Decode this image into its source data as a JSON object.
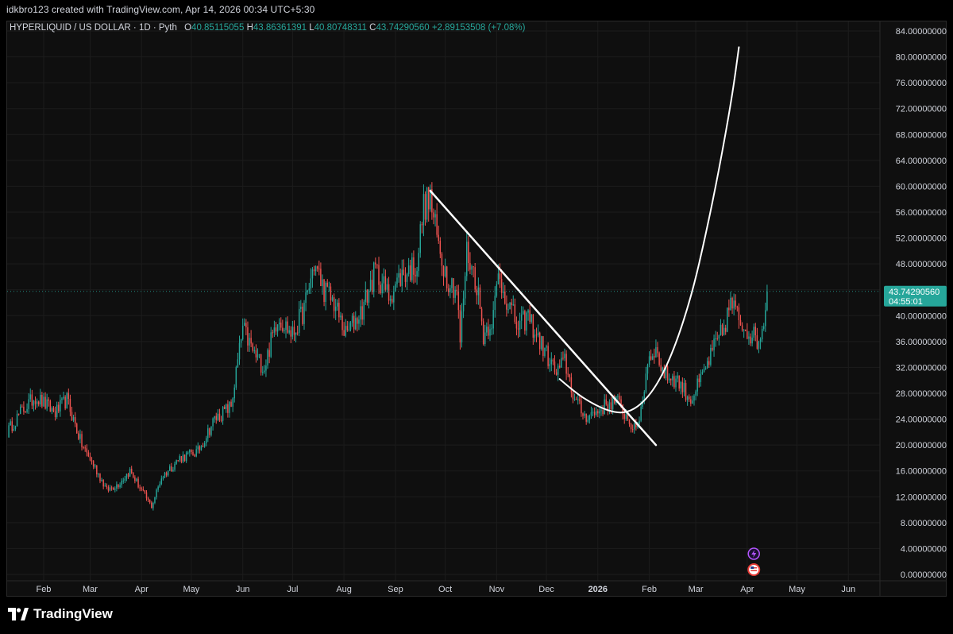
{
  "header": {
    "credit": "idkbro123 created with TradingView.com, Apr 14, 2026 00:34 UTC+5:30"
  },
  "legend": {
    "symbol": "HYPERLIQUID / US DOLLAR · 1D · Pyth",
    "open_label": "O",
    "open": "40.85115055",
    "high_label": "H",
    "high": "43.86361391",
    "low_label": "L",
    "low": "40.80748311",
    "close_label": "C",
    "close": "43.74290560",
    "change": "+2.89153508 (+7.08%)"
  },
  "price_label": {
    "value": "43.74290560",
    "countdown": "04:55:01",
    "price": 43.7429056
  },
  "brand": {
    "name": "TradingView"
  },
  "colors": {
    "up": "#26a69a",
    "down": "#ef5350",
    "background": "#0f0f0f",
    "axis_text": "#d1d4dc",
    "drawing": "#ffffff"
  },
  "icons": [
    "lightning-icon",
    "us-flag-icon"
  ],
  "chart_data": {
    "type": "candlestick",
    "y_scale": "linear",
    "ylim": [
      0,
      84
    ],
    "y_ticks": [
      0,
      4,
      8,
      12,
      16,
      20,
      24,
      28,
      32,
      36,
      40,
      44,
      48,
      52,
      56,
      60,
      64,
      68,
      72,
      76,
      80,
      84
    ],
    "y_tick_labels": [
      "0.00000000",
      "4.00000000",
      "8.00000000",
      "12.00000000",
      "16.00000000",
      "20.00000000",
      "24.00000000",
      "28.00000000",
      "32.00000000",
      "36.00000000",
      "40.00000000",
      "44.00000000",
      "48.00000000",
      "52.00000000",
      "56.00000000",
      "60.00000000",
      "64.00000000",
      "68.00000000",
      "72.00000000",
      "76.00000000",
      "80.00000000",
      "84.00000000"
    ],
    "x_ticks": [
      {
        "label": "Feb",
        "date": "2025-02-01",
        "bold": false
      },
      {
        "label": "Mar",
        "date": "2025-03-01",
        "bold": false
      },
      {
        "label": "Apr",
        "date": "2025-04-01",
        "bold": false
      },
      {
        "label": "May",
        "date": "2025-05-01",
        "bold": false
      },
      {
        "label": "Jun",
        "date": "2025-06-01",
        "bold": false
      },
      {
        "label": "Jul",
        "date": "2025-07-01",
        "bold": false
      },
      {
        "label": "Aug",
        "date": "2025-08-01",
        "bold": false
      },
      {
        "label": "Sep",
        "date": "2025-09-01",
        "bold": false
      },
      {
        "label": "Oct",
        "date": "2025-10-01",
        "bold": false
      },
      {
        "label": "Nov",
        "date": "2025-11-01",
        "bold": false
      },
      {
        "label": "Dec",
        "date": "2025-12-01",
        "bold": false
      },
      {
        "label": "2026",
        "date": "2026-01-01",
        "bold": true
      },
      {
        "label": "Feb",
        "date": "2026-02-01",
        "bold": false
      },
      {
        "label": "Mar",
        "date": "2026-03-01",
        "bold": false
      },
      {
        "label": "Apr",
        "date": "2026-04-01",
        "bold": false
      },
      {
        "label": "May",
        "date": "2026-05-01",
        "bold": false
      },
      {
        "label": "Jun",
        "date": "2026-06-01",
        "bold": false
      }
    ],
    "x_range": [
      "2025-01-10",
      "2026-06-20"
    ],
    "first_date": "2025-01-10",
    "anchors": [
      [
        "2025-01-10",
        22
      ],
      [
        "2025-01-18",
        25
      ],
      [
        "2025-01-27",
        27.5
      ],
      [
        "2025-02-08",
        25
      ],
      [
        "2025-02-15",
        27
      ],
      [
        "2025-02-24",
        20
      ],
      [
        "2025-03-04",
        16.5
      ],
      [
        "2025-03-11",
        13
      ],
      [
        "2025-03-18",
        14
      ],
      [
        "2025-03-25",
        16
      ],
      [
        "2025-04-01",
        13
      ],
      [
        "2025-04-07",
        10.5
      ],
      [
        "2025-04-13",
        15
      ],
      [
        "2025-04-24",
        18
      ],
      [
        "2025-05-05",
        19
      ],
      [
        "2025-05-15",
        24
      ],
      [
        "2025-05-25",
        26
      ],
      [
        "2025-06-01",
        38
      ],
      [
        "2025-06-08",
        34
      ],
      [
        "2025-06-14",
        32
      ],
      [
        "2025-06-22",
        40
      ],
      [
        "2025-07-01",
        37
      ],
      [
        "2025-07-08",
        41
      ],
      [
        "2025-07-14",
        48
      ],
      [
        "2025-07-20",
        44
      ],
      [
        "2025-07-26",
        42
      ],
      [
        "2025-08-02",
        37
      ],
      [
        "2025-08-12",
        41
      ],
      [
        "2025-08-20",
        47
      ],
      [
        "2025-08-28",
        43
      ],
      [
        "2025-09-04",
        46
      ],
      [
        "2025-09-14",
        48
      ],
      [
        "2025-09-18",
        57
      ],
      [
        "2025-09-22",
        58
      ],
      [
        "2025-09-26",
        52
      ],
      [
        "2025-10-02",
        46
      ],
      [
        "2025-10-08",
        44
      ],
      [
        "2025-10-10",
        36
      ],
      [
        "2025-10-14",
        50
      ],
      [
        "2025-10-20",
        45
      ],
      [
        "2025-10-24",
        37
      ],
      [
        "2025-10-30",
        40
      ],
      [
        "2025-11-02",
        46
      ],
      [
        "2025-11-08",
        42
      ],
      [
        "2025-11-14",
        38
      ],
      [
        "2025-11-20",
        40
      ],
      [
        "2025-11-25",
        37
      ],
      [
        "2025-12-01",
        34
      ],
      [
        "2025-12-07",
        31
      ],
      [
        "2025-12-12",
        33
      ],
      [
        "2025-12-18",
        27
      ],
      [
        "2025-12-24",
        24.5
      ],
      [
        "2025-12-31",
        25
      ],
      [
        "2026-01-05",
        26
      ],
      [
        "2026-01-12",
        27
      ],
      [
        "2026-01-18",
        24.5
      ],
      [
        "2026-01-24",
        22
      ],
      [
        "2026-01-28",
        27
      ],
      [
        "2026-01-31",
        33
      ],
      [
        "2026-02-04",
        35
      ],
      [
        "2026-02-10",
        31
      ],
      [
        "2026-02-18",
        30
      ],
      [
        "2026-02-26",
        27
      ],
      [
        "2026-03-04",
        30
      ],
      [
        "2026-03-12",
        35
      ],
      [
        "2026-03-18",
        38
      ],
      [
        "2026-03-22",
        42
      ],
      [
        "2026-03-28",
        39
      ],
      [
        "2026-04-04",
        37
      ],
      [
        "2026-04-08",
        36
      ],
      [
        "2026-04-12",
        40.85
      ],
      [
        "2026-04-13",
        43.74
      ]
    ],
    "drawings": [
      {
        "type": "trendline",
        "points": [
          [
            "2025-09-22",
            59.3
          ],
          [
            "2026-02-05",
            20.0
          ]
        ]
      },
      {
        "type": "curve",
        "points": [
          [
            "2025-12-09",
            30.2
          ],
          [
            "2025-12-18",
            28.2
          ],
          [
            "2025-12-28",
            26.5
          ],
          [
            "2026-01-08",
            25.2
          ],
          [
            "2026-01-18",
            24.9
          ],
          [
            "2026-01-28",
            26.4
          ],
          [
            "2026-02-07",
            29.8
          ],
          [
            "2026-02-17",
            35.5
          ],
          [
            "2026-02-27",
            43.6
          ],
          [
            "2026-03-07",
            52.5
          ],
          [
            "2026-03-15",
            62.5
          ],
          [
            "2026-03-23",
            74.0
          ],
          [
            "2026-03-27",
            81.5
          ]
        ]
      }
    ]
  }
}
